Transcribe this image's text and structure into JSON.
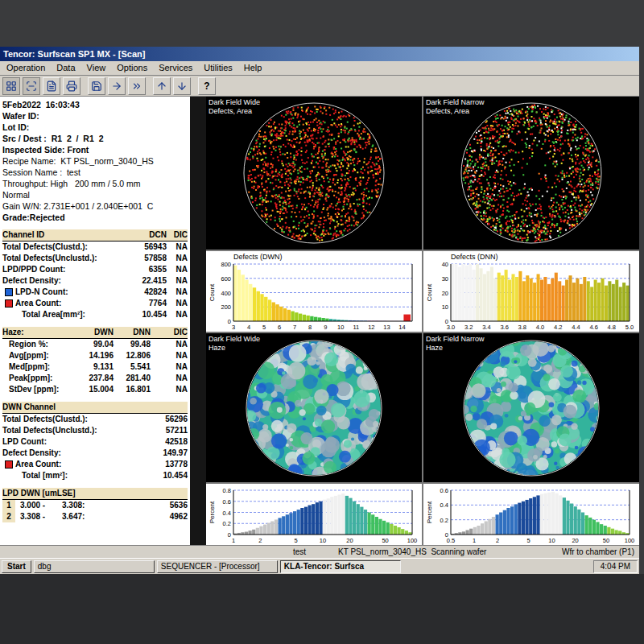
{
  "window": {
    "title": "Tencor: Surfscan SP1 MX - [Scan]"
  },
  "menu": [
    "Operation",
    "Data",
    "View",
    "Options",
    "Services",
    "Utilities",
    "Help"
  ],
  "toolbar": {
    "help": "?"
  },
  "header": [
    {
      "text": "5Feb2022  16:03:43",
      "bold": true
    },
    {
      "text": "Wafer ID:",
      "bold": true
    },
    {
      "text": "Lot ID:",
      "bold": true
    },
    {
      "text": "Src / Dest :  R1  2  /  R1  2",
      "bold": true
    },
    {
      "text": "Inspected Side: Front",
      "bold": true
    },
    {
      "text": "Recipe Name:  KT PSL_norm_3040_HS",
      "bold": false
    },
    {
      "text": "Session Name :  test",
      "bold": false
    },
    {
      "text": "Throughput: High   200 mm / 5.0 mm",
      "bold": false
    },
    {
      "text": "Normal",
      "bold": false
    },
    {
      "text": "Gain W/N: 2.731E+001 / 2.040E+001  C",
      "bold": false
    },
    {
      "text": "Grade:Rejected",
      "bold": true
    }
  ],
  "channel_table": {
    "columns": [
      "Channel ID",
      "DCN",
      "DIC"
    ],
    "rows": [
      {
        "label": "Total Defects(Clustd.):",
        "values": [
          "56943",
          "NA"
        ],
        "indent": false
      },
      {
        "label": "Total Defects(Unclustd.):",
        "values": [
          "57858",
          "NA"
        ],
        "indent": false
      },
      {
        "label": "LPD/PPD Count:",
        "values": [
          "6355",
          "NA"
        ],
        "indent": false
      },
      {
        "label": "Defect Density:",
        "values": [
          "22.415",
          "NA"
        ],
        "indent": false
      },
      {
        "label": "LPD-N Count:",
        "values": [
          "42824",
          "NA"
        ],
        "indent": false,
        "color": "#1e63d6"
      },
      {
        "label": "Area Count:",
        "values": [
          "7764",
          "NA"
        ],
        "indent": false,
        "color": "#e01e1e"
      },
      {
        "label": "Total Area[mm²]:",
        "values": [
          "10.454",
          "NA"
        ],
        "indent": true
      }
    ]
  },
  "haze_table": {
    "columns": [
      "Haze:",
      "DWN",
      "DNN",
      "DIC"
    ],
    "rows": [
      {
        "label": "Region %:",
        "values": [
          "99.04",
          "99.48",
          "NA"
        ]
      },
      {
        "label": "Avg[ppm]:",
        "values": [
          "14.196",
          "12.806",
          "NA"
        ]
      },
      {
        "label": "Med[ppm]:",
        "values": [
          "9.131",
          "5.541",
          "NA"
        ]
      },
      {
        "label": "Peak[ppm]:",
        "values": [
          "237.84",
          "281.40",
          "NA"
        ]
      },
      {
        "label": "StDev [ppm]:",
        "values": [
          "15.004",
          "16.801",
          "NA"
        ]
      }
    ]
  },
  "dwn_table": {
    "title": "DWN Channel",
    "rows": [
      {
        "label": "Total Defects(Clustd.):",
        "value": "56296",
        "indent": false
      },
      {
        "label": "Total Defects(Unclustd.):",
        "value": "57211",
        "indent": false
      },
      {
        "label": "LPD Count:",
        "value": "42518",
        "indent": false
      },
      {
        "label": "Defect Density:",
        "value": "149.97",
        "indent": false
      },
      {
        "label": "Area Count:",
        "value": "13778",
        "indent": false,
        "color": "#e01e1e"
      },
      {
        "label": "Total [mm²]:",
        "value": "10.454",
        "indent": true
      }
    ]
  },
  "lpd_table": {
    "title": "LPD DWN [umLSE]",
    "rows": [
      {
        "index": "1",
        "from": "3.000 -",
        "to": "3.308:",
        "count": "5636"
      },
      {
        "index": "2",
        "from": "3.308 -",
        "to": "3.647:",
        "count": "4962"
      }
    ]
  },
  "maps": [
    {
      "title": "Dark Field Wide",
      "subtitle": "Defects, Area",
      "kind": "defects"
    },
    {
      "title": "Dark Field Narrow",
      "subtitle": "Defects, Area",
      "kind": "defects"
    },
    {
      "title": "Dark Field Wide",
      "subtitle": "Haze",
      "kind": "haze"
    },
    {
      "title": "Dark Field Narrow",
      "subtitle": "Haze",
      "kind": "haze"
    }
  ],
  "defect_charts": [
    {
      "title": "Defects (DWN)",
      "y_label": "Count",
      "scale": "linear",
      "y_ticks": [
        "800",
        "600",
        "400",
        "200",
        "0"
      ],
      "x_ticks": [
        "3",
        "4",
        "5",
        "6",
        "7",
        "8",
        "9",
        "10",
        "11",
        "12",
        "13",
        "14"
      ],
      "values": [
        780,
        720,
        650,
        580,
        520,
        470,
        420,
        380,
        340,
        300,
        265,
        235,
        205,
        180,
        160,
        140,
        122,
        106,
        92,
        80,
        70,
        60,
        52,
        45,
        38,
        32,
        27,
        22,
        18,
        15,
        12,
        10,
        8,
        7,
        6,
        5,
        4,
        4,
        3,
        3,
        2,
        2,
        2,
        1
      ],
      "overflow": 95
    },
    {
      "title": "Defects (DNN)",
      "y_label": "Count",
      "scale": "linear",
      "y_ticks": [
        "40",
        "30",
        "20",
        "10",
        "0"
      ],
      "x_ticks": [
        "3.0",
        "3.2",
        "3.4",
        "3.6",
        "3.8",
        "4.0",
        "4.2",
        "4.4",
        "4.6",
        "4.8",
        "5.0"
      ],
      "values": [
        40,
        42,
        38,
        41,
        39,
        44,
        36,
        40,
        37,
        33,
        35,
        38,
        30,
        34,
        32,
        36,
        29,
        33,
        31,
        35,
        28,
        32,
        30,
        27,
        33,
        29,
        31,
        26,
        30,
        34,
        28,
        25,
        29,
        32,
        27,
        30,
        26,
        31,
        28,
        24,
        29,
        27,
        30,
        25,
        28,
        26,
        29,
        24,
        27,
        25
      ]
    }
  ],
  "haze_charts": [
    {
      "y_label": "Percent",
      "scale": "log",
      "y_ticks": [
        "0.8",
        "0.6",
        "0.4",
        "0.2",
        "0"
      ],
      "x_ticks": [
        "1",
        "2",
        "5",
        "10",
        "20",
        "50",
        "100"
      ],
      "values": [
        0.02,
        0.03,
        0.04,
        0.05,
        0.07,
        0.09,
        0.12,
        0.15,
        0.18,
        0.21,
        0.24,
        0.27,
        0.3,
        0.33,
        0.36,
        0.39,
        0.42,
        0.45,
        0.48,
        0.5,
        0.53,
        0.55,
        0.58,
        0.6,
        0.63,
        0.65,
        0.68,
        0.7,
        0.72,
        0.74,
        0.7,
        0.66,
        0.6,
        0.55,
        0.5,
        0.45,
        0.4,
        0.36,
        0.32,
        0.28,
        0.25,
        0.22,
        0.19,
        0.16,
        0.13,
        0.1,
        0.07,
        0.04
      ]
    },
    {
      "y_label": "Percent",
      "scale": "log",
      "y_ticks": [
        "0.6",
        "0.4",
        "0.2",
        "0"
      ],
      "x_ticks": [
        "0.5",
        "1",
        "2",
        "5",
        "10",
        "20",
        "50",
        "100"
      ],
      "values": [
        0.01,
        0.02,
        0.03,
        0.04,
        0.06,
        0.08,
        0.1,
        0.12,
        0.15,
        0.18,
        0.21,
        0.24,
        0.27,
        0.3,
        0.33,
        0.36,
        0.38,
        0.41,
        0.43,
        0.45,
        0.47,
        0.49,
        0.51,
        0.53,
        0.55,
        0.56,
        0.57,
        0.58,
        0.56,
        0.53,
        0.5,
        0.46,
        0.42,
        0.38,
        0.34,
        0.3,
        0.26,
        0.23,
        0.2,
        0.17,
        0.14,
        0.12,
        0.1,
        0.08,
        0.06,
        0.05,
        0.03,
        0.02
      ]
    }
  ],
  "status_bar": [
    "test",
    "KT PSL_norm_3040_HS  Scanning wafer",
    "Wfr to chamber (P1)"
  ],
  "taskbar": {
    "start": "Start",
    "tasks": [
      {
        "label": "dbg",
        "selected": false
      },
      {
        "label": "SEQUENCER - [Processor]",
        "selected": false
      },
      {
        "label": "KLA-Tencor: Surfsca",
        "selected": true
      }
    ],
    "clock": "4:04 PM"
  }
}
